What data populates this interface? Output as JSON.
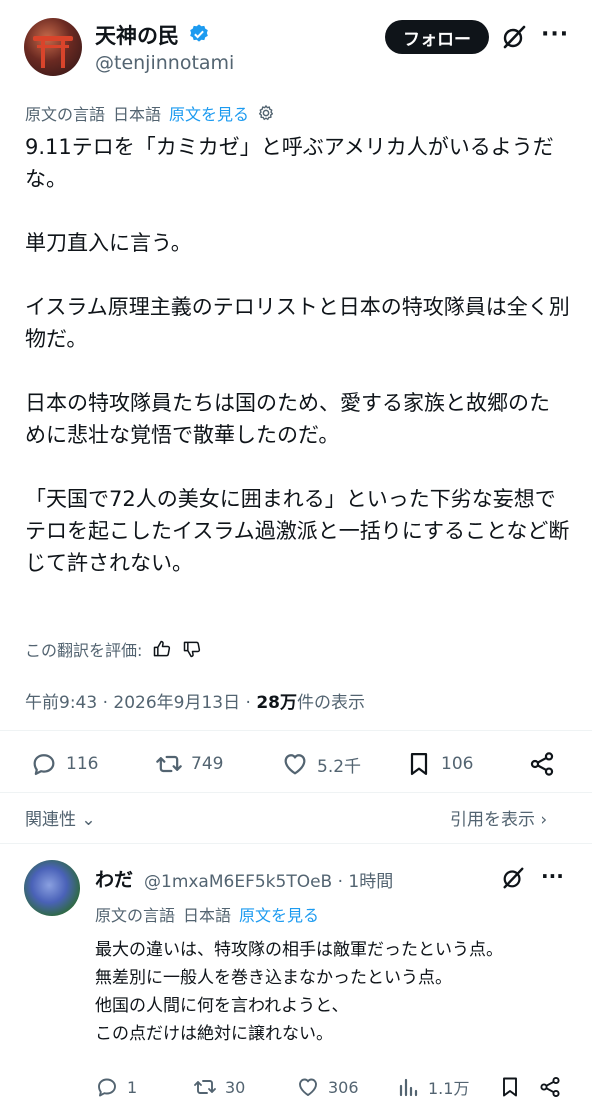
{
  "author": {
    "display_name": "天神の民",
    "handle": "@tenjinnotami",
    "follow_label": "フォロー"
  },
  "translation": {
    "label": "原文の言語",
    "language": "日本語",
    "show_original": "原文を見る"
  },
  "tweet": {
    "text": "9.11テロを「カミカゼ」と呼ぶアメリカ人がいるようだな。\n\n単刀直入に言う。\n\nイスラム原理主義のテロリストと日本の特攻隊員は全く別物だ。\n\n日本の特攻隊員たちは国のため、愛する家族と故郷のために悲壮な覚悟で散華したのだ。\n\n「天国で72人の美女に囲まれる」といった下劣な妄想でテロを起こしたイスラム過激派と一括りにすることなど断じて許されない。",
    "rate_translation": "この翻訳を評価:",
    "time": "午前9:43 · 2026年9月13日 · ",
    "views_count": "28万",
    "views_suffix": "件の表示"
  },
  "actions": {
    "replies": "116",
    "retweets": "749",
    "likes": "5.2千",
    "bookmarks": "106"
  },
  "related_label": "関連性 ⌄",
  "quotes_label": "引用を表示 ›",
  "reply": {
    "display_name": "わだ",
    "meta": "@1mxaM6EF5k5TOeB · 1時間",
    "trans_label": "原文の言語",
    "trans_language": "日本語",
    "trans_show": "原文を見る",
    "text": "最大の違いは、特攻隊の相手は敵軍だったという点。\n無差別に一般人を巻き込まなかったという点。\n他国の人間に何を言われようと、\nこの点だけは絶対に譲れない。",
    "replies": "1",
    "retweets": "30",
    "likes": "306",
    "views": "1.1万"
  },
  "colors": {
    "accent": "#1d9bf0",
    "text": "#0f1419",
    "secondary": "#536471"
  }
}
